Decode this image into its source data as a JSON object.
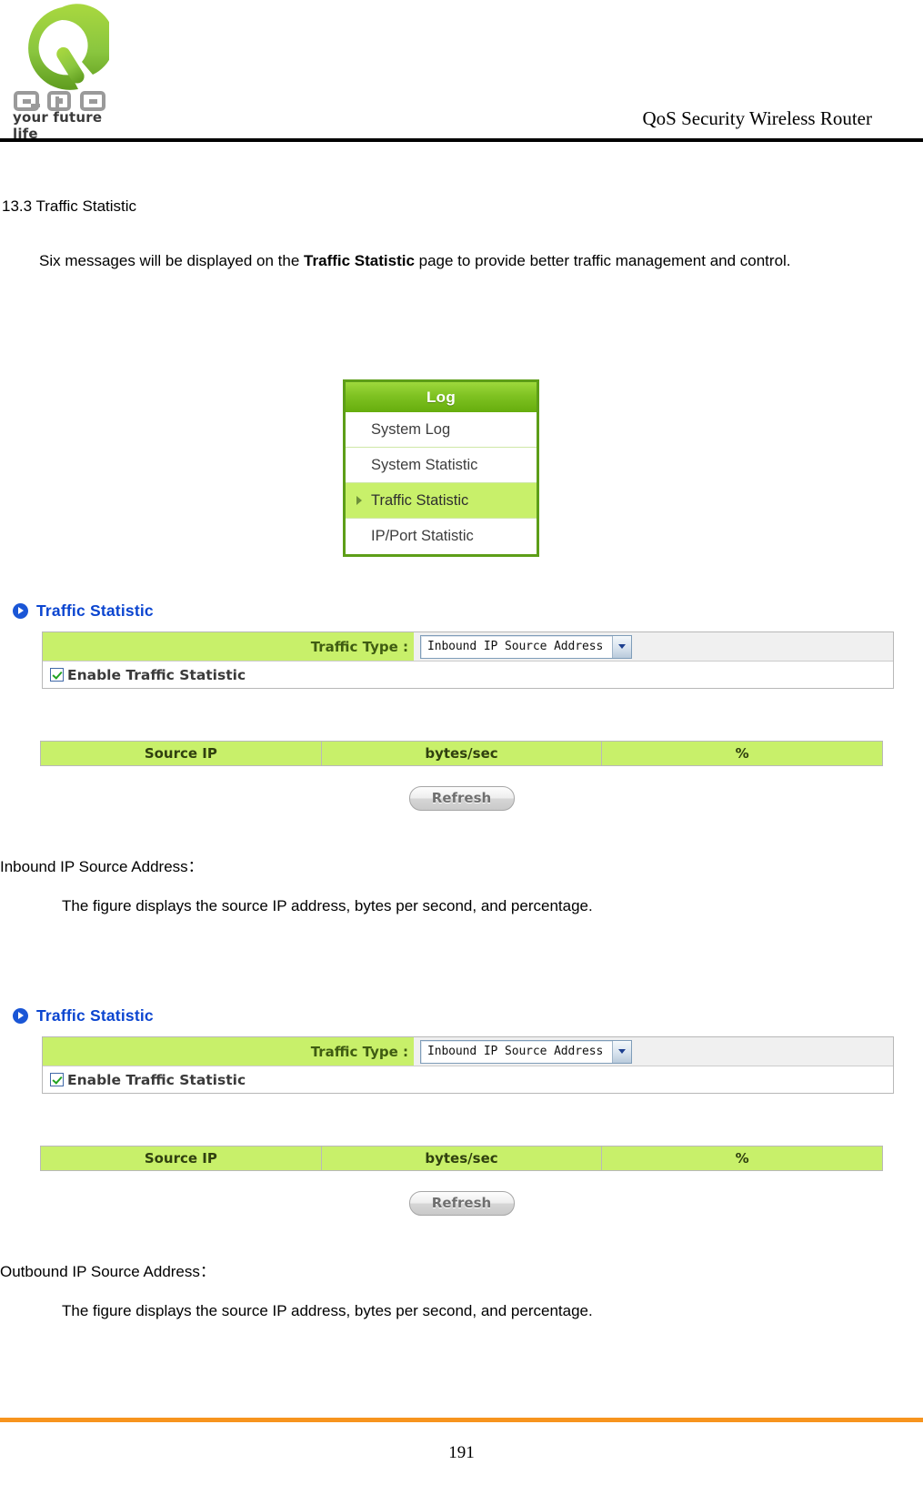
{
  "header": {
    "product_title": "QoS Security Wireless Router",
    "logo_word": "QNO",
    "logo_tagline": "your future life"
  },
  "document": {
    "section_title": "13.3 Traffic Statistic",
    "intro_part1": "Six messages will be displayed on the ",
    "intro_bold": "Traffic Statistic",
    "intro_part2": " page to provide better traffic management and control.",
    "subhead_inbound": "Inbound IP Source Address：",
    "subhead_outbound": "Outbound IP Source Address：",
    "desc_inbound": "The figure displays the source IP address, bytes per second, and percentage.",
    "desc_outbound": "The figure displays the source IP address, bytes per second, and percentage."
  },
  "log_menu": {
    "title": "Log",
    "items": [
      {
        "label": "System Log",
        "active": false
      },
      {
        "label": "System Statistic",
        "active": false
      },
      {
        "label": "Traffic Statistic",
        "active": true
      },
      {
        "label": "IP/Port Statistic",
        "active": false
      }
    ]
  },
  "panels": [
    {
      "heading": "Traffic Statistic",
      "traffic_type_label": "Traffic Type :",
      "traffic_type_value": "Inbound IP Source Address",
      "enable_label": "Enable Traffic Statistic",
      "enable_checked": true,
      "table_headers": [
        "Source IP",
        "bytes/sec",
        "%"
      ],
      "refresh_label": "Refresh"
    },
    {
      "heading": "Traffic Statistic",
      "traffic_type_label": "Traffic Type :",
      "traffic_type_value": "Inbound IP Source Address",
      "enable_label": "Enable Traffic Statistic",
      "enable_checked": true,
      "table_headers": [
        "Source IP",
        "bytes/sec",
        "%"
      ],
      "refresh_label": "Refresh"
    }
  ],
  "footer": {
    "page_number": "191"
  },
  "colors": {
    "accent_green": "#c8f06a",
    "menu_green": "#7fc222",
    "heading_blue": "#0b45d0",
    "footer_orange": "#f7941e"
  }
}
